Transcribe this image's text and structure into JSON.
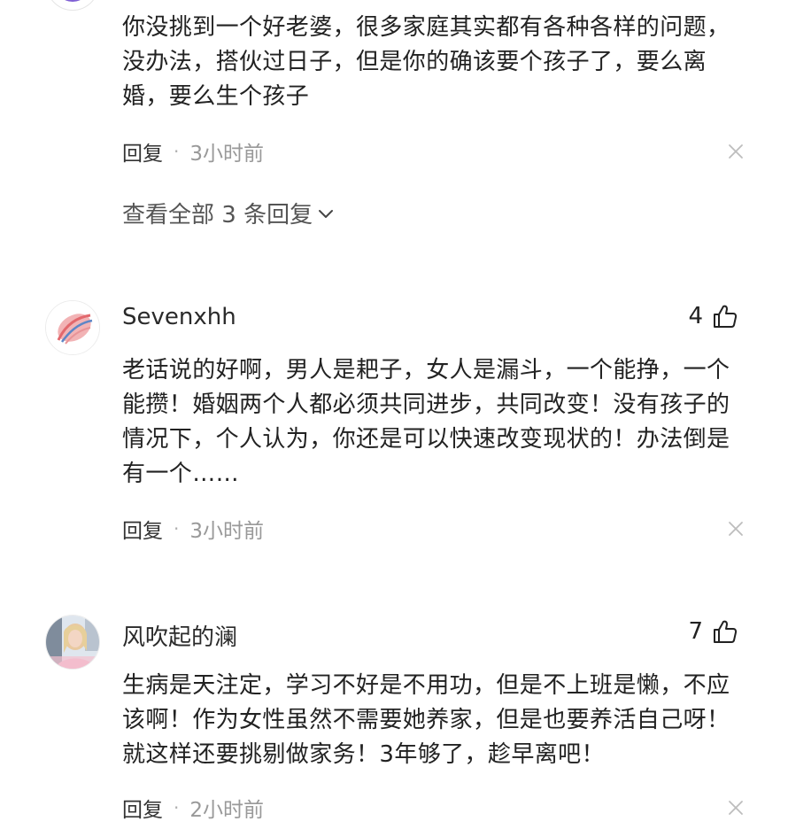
{
  "comments": [
    {
      "text": "你没挑到一个好老婆，很多家庭其实都有各种各样的问题，没办法，搭伙过日子，但是你的确该要个孩子了，要么离婚，要么生个孩子",
      "reply_label": "回复",
      "time": "3小时前",
      "view_all": "查看全部 3 条回复"
    },
    {
      "username": "Sevenxhh",
      "likes": "4",
      "text": "老话说的好啊，男人是耙子，女人是漏斗，一个能挣，一个能攒！婚姻两个人都必须共同进步，共同改变！没有孩子的情况下，个人认为，你还是可以快速改变现状的！办法倒是有一个……",
      "reply_label": "回复",
      "time": "3小时前"
    },
    {
      "username": "风吹起的澜",
      "likes": "7",
      "text": "生病是天注定，学习不好是不用功，但是不上班是懒，不应该啊！作为女性虽然不需要她养家，但是也要养活自己呀！就这样还要挑剔做家务！3年够了，趁早离吧！",
      "reply_label": "回复",
      "time": "2小时前"
    }
  ],
  "separator": "·",
  "icons": {
    "close": "close-icon",
    "chevron": "chevron-down-icon",
    "like": "thumbs-up-icon"
  }
}
